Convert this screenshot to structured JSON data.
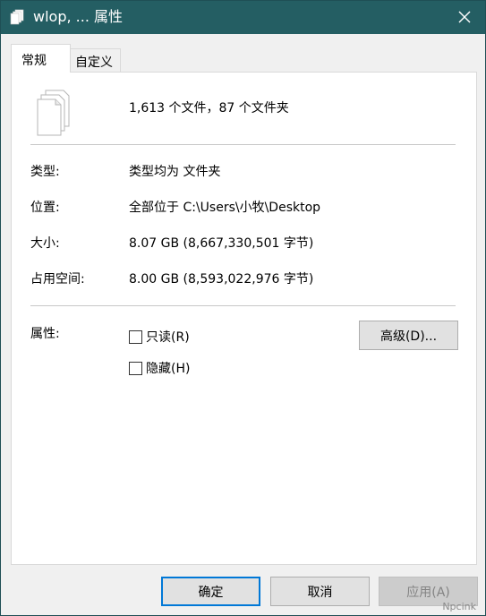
{
  "window": {
    "title": "wlop, ... 属性",
    "close_icon": "close-icon"
  },
  "tabs": [
    {
      "label": "常规",
      "active": true
    },
    {
      "label": "自定义",
      "active": false
    }
  ],
  "summary": {
    "icon": "multiple-files-icon",
    "text": "1,613 个文件，87 个文件夹"
  },
  "properties": [
    {
      "label": "类型:",
      "value": "类型均为 文件夹"
    },
    {
      "label": "位置:",
      "value": "全部位于 C:\\Users\\小牧\\Desktop"
    },
    {
      "label": "大小:",
      "value": "8.07 GB (8,667,330,501 字节)"
    },
    {
      "label": "占用空间:",
      "value": "8.00 GB (8,593,022,976 字节)"
    }
  ],
  "attributes": {
    "label": "属性:",
    "readonly": {
      "label": "只读(R)",
      "checked": false
    },
    "hidden": {
      "label": "隐藏(H)",
      "checked": false
    },
    "advanced_button": "高级(D)..."
  },
  "buttons": {
    "ok": "确定",
    "cancel": "取消",
    "apply": "应用(A)"
  },
  "watermark": "Npcink",
  "colors": {
    "titlebar": "#245e63",
    "accent": "#0078d7",
    "panel": "#ffffff",
    "window": "#f0f0f0"
  }
}
